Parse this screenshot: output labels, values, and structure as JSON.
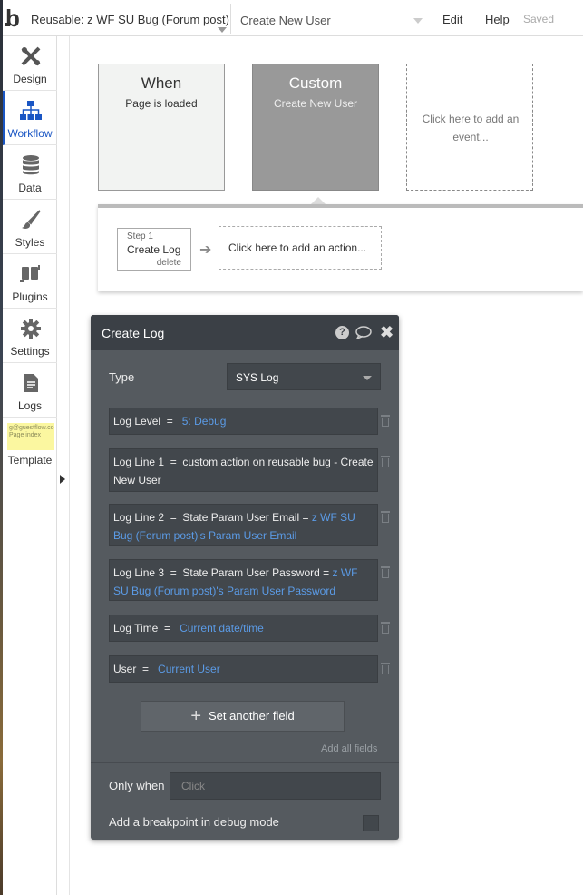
{
  "topbar": {
    "logo_text": "b",
    "page_name": "Reusable: z WF SU Bug (Forum post)",
    "event_name": "Create New User",
    "menu_edit": "Edit",
    "menu_help": "Help",
    "status": "Saved"
  },
  "sidebar": {
    "items": [
      {
        "label": "Design",
        "icon": "design-icon"
      },
      {
        "label": "Workflow",
        "icon": "workflow-icon",
        "active": true
      },
      {
        "label": "Data",
        "icon": "database-icon"
      },
      {
        "label": "Styles",
        "icon": "brush-icon"
      },
      {
        "label": "Plugins",
        "icon": "plug-icon"
      },
      {
        "label": "Settings",
        "icon": "gear-icon"
      },
      {
        "label": "Logs",
        "icon": "document-icon"
      },
      {
        "label": "Template",
        "icon": "template-thumbnail"
      }
    ],
    "template_thumb_text": "g@guestflow.co Page index",
    "active_color": "#1a56c4"
  },
  "events": {
    "when": {
      "title": "When",
      "subtitle": "Page is loaded"
    },
    "custom": {
      "title": "Custom",
      "subtitle": "Create New User"
    },
    "add": {
      "text": "Click here to add an event..."
    }
  },
  "actions": {
    "step": {
      "number": "Step 1",
      "name": "Create Log",
      "delete": "delete"
    },
    "add_text": "Click here to add an action..."
  },
  "panel": {
    "title": "Create Log",
    "type_label": "Type",
    "type_value": "SYS Log",
    "fields": [
      {
        "label": "Log Level",
        "eq": "=",
        "value": "",
        "hl": "5: Debug"
      },
      {
        "label": "Log Line 1",
        "eq": "=",
        "value": "custom action on reusable bug - Create New User",
        "hl": ""
      },
      {
        "label": "Log Line 2",
        "eq": "=",
        "value": "State Param User Email = ",
        "hl": "z WF SU Bug (Forum post)'s Param User Email"
      },
      {
        "label": "Log Line 3",
        "eq": "=",
        "value": "State Param User Password = ",
        "hl": "z WF SU Bug (Forum post)'s Param User Password"
      },
      {
        "label": "Log Time",
        "eq": "=",
        "value": "",
        "hl": "Current date/time"
      },
      {
        "label": "User",
        "eq": "=",
        "value": "",
        "hl": "Current User"
      }
    ],
    "set_another": "Set another field",
    "add_all": "Add all fields",
    "only_when_label": "Only when",
    "only_when_placeholder": "Click",
    "breakpoint_label": "Add a breakpoint in debug mode",
    "help_glyph": "?",
    "close_glyph": "✖",
    "highlight_color": "#5b9be6"
  }
}
